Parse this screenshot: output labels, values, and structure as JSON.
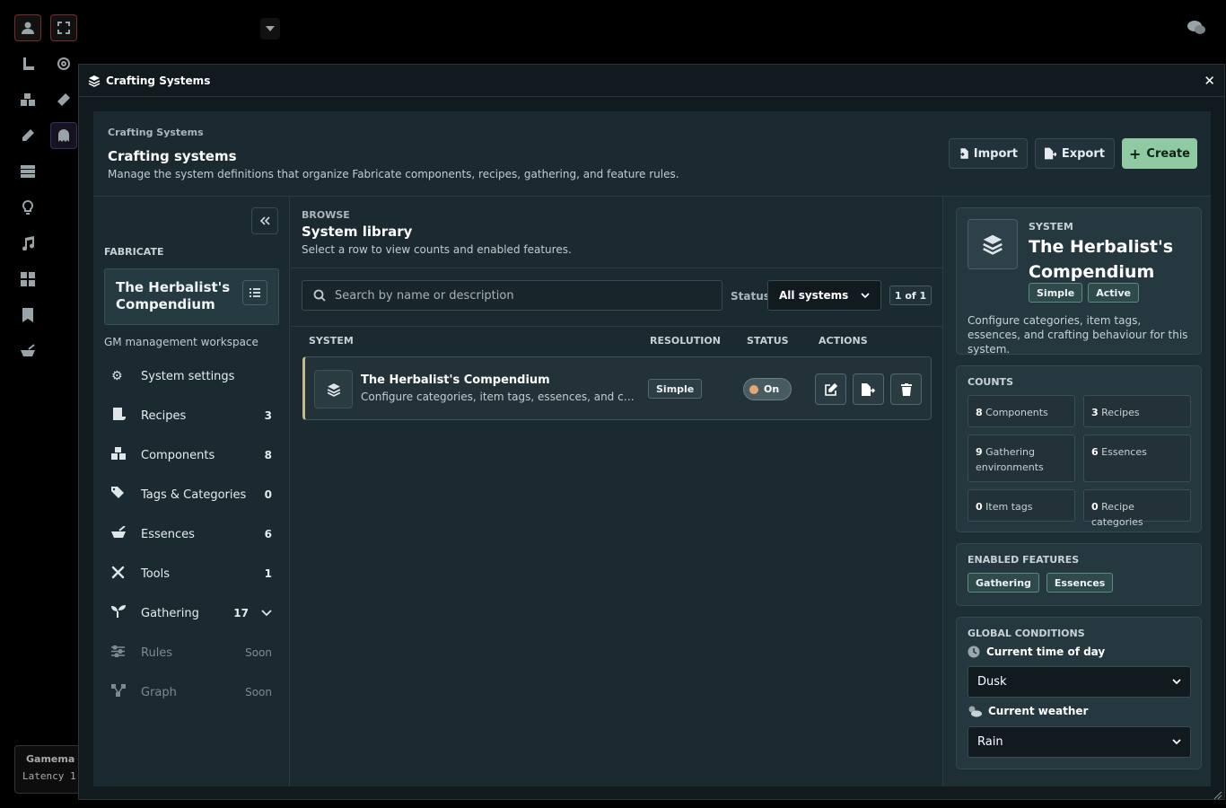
{
  "window": {
    "title": "Crafting Systems",
    "close": "✕"
  },
  "header": {
    "eyebrow": "Crafting Systems",
    "title": "Crafting systems",
    "description": "Manage the system definitions that organize Fabricate components, recipes, gathering, and feature rules.",
    "import_label": "Import",
    "export_label": "Export",
    "create_label": "Create"
  },
  "sidebar": {
    "section_label": "FABRICATE",
    "system_name": "The Herbalist's Compendium",
    "workspace_label": "GM management workspace",
    "items": [
      {
        "label": "System settings",
        "count": "",
        "icon": "gear-icon"
      },
      {
        "label": "Recipes",
        "count": "3",
        "icon": "scroll-icon"
      },
      {
        "label": "Components",
        "count": "8",
        "icon": "cubes-icon"
      },
      {
        "label": "Tags & Categories",
        "count": "0",
        "icon": "tags-icon"
      },
      {
        "label": "Essences",
        "count": "6",
        "icon": "mortar-icon"
      },
      {
        "label": "Tools",
        "count": "1",
        "icon": "tools-icon"
      },
      {
        "label": "Gathering",
        "count": "17",
        "icon": "seedling-icon"
      },
      {
        "label": "Rules",
        "count": "Soon",
        "icon": "sliders-icon"
      },
      {
        "label": "Graph",
        "count": "Soon",
        "icon": "graph-icon"
      }
    ]
  },
  "browse": {
    "eyebrow": "BROWSE",
    "title": "System library",
    "description": "Select a row to view counts and enabled features.",
    "search_placeholder": "Search by name or description",
    "status_label": "Status",
    "status_value": "All systems",
    "pager": "1 of 1",
    "columns": {
      "system": "SYSTEM",
      "resolution": "RESOLUTION",
      "status": "STATUS",
      "actions": "ACTIONS"
    },
    "row": {
      "name": "The Herbalist's Compendium",
      "description": "Configure categories, item tags, essences, and crafting behaviour for this system.",
      "resolution": "Simple",
      "status": "On"
    }
  },
  "details": {
    "eyebrow": "SYSTEM",
    "name": "The Herbalist's Compendium",
    "badges": [
      "Simple",
      "Active"
    ],
    "description": "Configure categories, item tags, essences, and crafting behaviour for this system.",
    "counts_label": "COUNTS",
    "counts": [
      {
        "n": "8",
        "label": "Components"
      },
      {
        "n": "3",
        "label": "Recipes"
      },
      {
        "n": "9",
        "label": "Gathering environments"
      },
      {
        "n": "6",
        "label": "Essences"
      },
      {
        "n": "0",
        "label": "Item tags"
      },
      {
        "n": "0",
        "label": "Recipe categories"
      }
    ],
    "features_label": "ENABLED FEATURES",
    "features": [
      "Gathering",
      "Essences"
    ],
    "global_label": "GLOBAL CONDITIONS",
    "time_label": "Current time of day",
    "time_value": "Dusk",
    "weather_label": "Current weather",
    "weather_value": "Rain"
  },
  "background": {
    "gamemaster_label": "Gamema",
    "latency_label": "Latency 1"
  },
  "colors": {
    "accent": "#8fcaa2",
    "row_highlight": "#c5b98c",
    "toggle_knob": "#e0a877"
  }
}
